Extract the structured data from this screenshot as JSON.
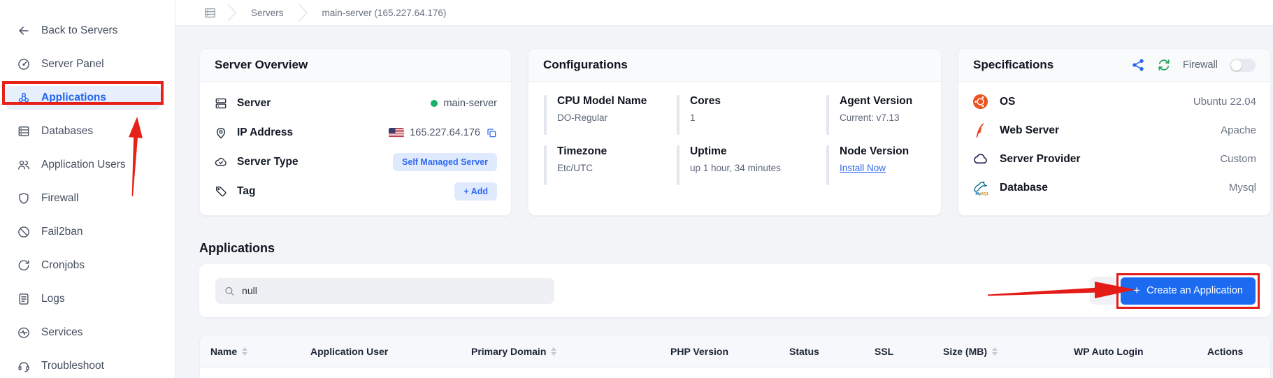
{
  "sidebar": {
    "back_label": "Back to Servers",
    "items": [
      {
        "label": "Server Panel"
      },
      {
        "label": "Applications"
      },
      {
        "label": "Databases"
      },
      {
        "label": "Application Users"
      },
      {
        "label": "Firewall"
      },
      {
        "label": "Fail2ban"
      },
      {
        "label": "Cronjobs"
      },
      {
        "label": "Logs"
      },
      {
        "label": "Services"
      },
      {
        "label": "Troubleshoot"
      }
    ]
  },
  "breadcrumb": {
    "items": [
      "Servers",
      "main-server (165.227.64.176)"
    ]
  },
  "overview": {
    "title": "Server Overview",
    "rows": [
      {
        "label": "Server",
        "value": "main-server"
      },
      {
        "label": "IP Address",
        "value": "165.227.64.176"
      },
      {
        "label": "Server Type",
        "value": "Self Managed Server"
      },
      {
        "label": "Tag",
        "value": "+ Add"
      }
    ]
  },
  "config": {
    "title": "Configurations",
    "items": [
      {
        "label": "CPU Model Name",
        "value": "DO-Regular"
      },
      {
        "label": "Cores",
        "value": "1"
      },
      {
        "label": "Agent Version",
        "value": "Current: v7.13"
      },
      {
        "label": "Timezone",
        "value": "Etc/UTC"
      },
      {
        "label": "Uptime",
        "value": "up 1 hour, 34 minutes"
      },
      {
        "label": "Node Version",
        "value": "Install Now"
      }
    ]
  },
  "specs": {
    "title": "Specifications",
    "firewall_label": "Firewall",
    "rows": [
      {
        "label": "OS",
        "value": "Ubuntu 22.04"
      },
      {
        "label": "Web Server",
        "value": "Apache"
      },
      {
        "label": "Server Provider",
        "value": "Custom"
      },
      {
        "label": "Database",
        "value": "Mysql"
      }
    ]
  },
  "applications": {
    "title": "Applications",
    "search_value": "null",
    "create_plus": "+",
    "create_label": "Create an Application",
    "table_headers": [
      {
        "label": "Name"
      },
      {
        "label": "Application User"
      },
      {
        "label": "Primary Domain"
      },
      {
        "label": "PHP Version"
      },
      {
        "label": "Status"
      },
      {
        "label": "SSL"
      },
      {
        "label": "Size (MB)"
      },
      {
        "label": "WP Auto Login"
      },
      {
        "label": "Actions"
      }
    ]
  },
  "colors": {
    "accent_blue": "#2465eb",
    "button_blue": "#1b6af0",
    "annotation_red": "#e62117",
    "status_green": "#17b26a",
    "refresh_green": "#1da355",
    "ubuntu_orange": "#e95420"
  }
}
